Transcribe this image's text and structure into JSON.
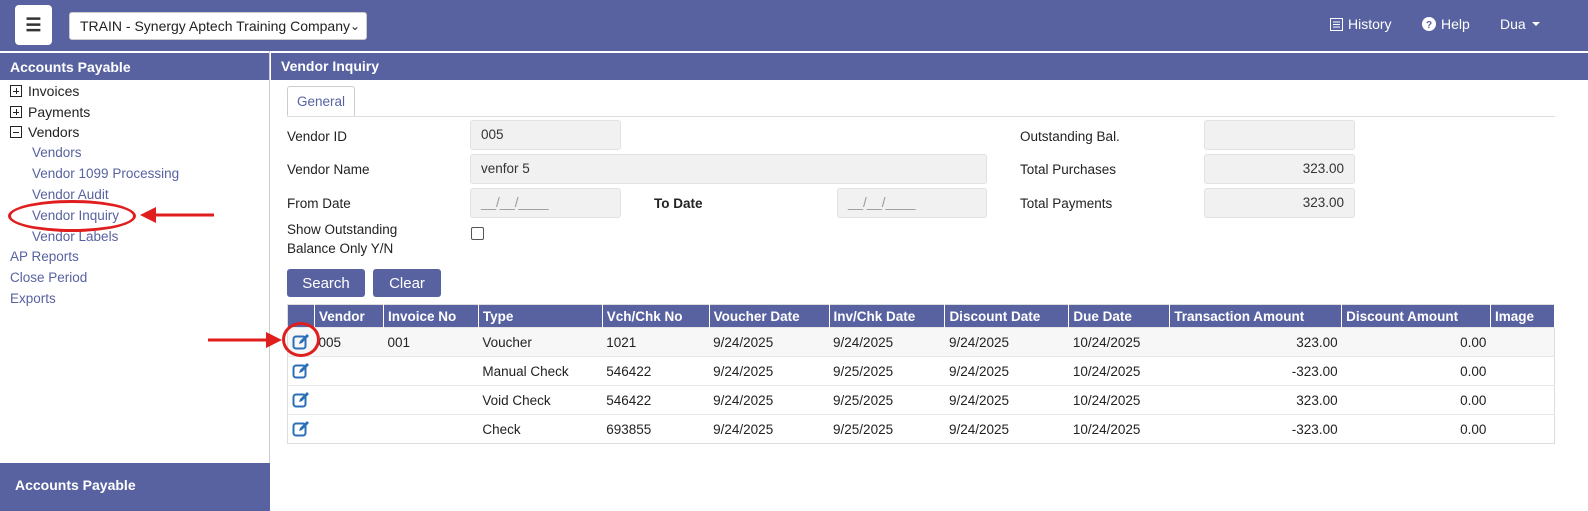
{
  "header": {
    "company": "TRAIN - Synergy Aptech Training Company",
    "history_label": "History",
    "help_label": "Help",
    "user_label": "Dua"
  },
  "sidebar": {
    "title": "Accounts Payable",
    "tree": [
      {
        "label": "Invoices",
        "state": "collapsed"
      },
      {
        "label": "Payments",
        "state": "collapsed"
      },
      {
        "label": "Vendors",
        "state": "expanded"
      }
    ],
    "vendor_links": [
      "Vendors",
      "Vendor 1099 Processing",
      "Vendor Audit",
      "Vendor Inquiry",
      "Vendor Labels"
    ],
    "top_links": [
      "AP Reports",
      "Close Period",
      "Exports"
    ],
    "footer": "Accounts Payable"
  },
  "main": {
    "title": "Vendor Inquiry",
    "tab": "General",
    "form": {
      "vendor_id_label": "Vendor ID",
      "vendor_id": "005",
      "vendor_name_label": "Vendor Name",
      "vendor_name": "venfor 5",
      "from_date_label": "From Date",
      "from_date_ph": "__/__/____",
      "to_date_label": "To Date",
      "to_date_ph": "__/__/____",
      "show_outstanding_label_1": "Show Outstanding",
      "show_outstanding_label_2": "Balance Only Y/N",
      "show_outstanding_checked": false,
      "outstanding_label": "Outstanding Bal.",
      "outstanding": "",
      "total_purchases_label": "Total Purchases",
      "total_purchases": "323.00",
      "total_payments_label": "Total Payments",
      "total_payments": "323.00"
    },
    "buttons": {
      "search": "Search",
      "clear": "Clear"
    },
    "columns": [
      "Vendor",
      "Invoice No",
      "Type",
      "Vch/Chk No",
      "Voucher Date",
      "Inv/Chk Date",
      "Discount Date",
      "Due Date",
      "Transaction Amount",
      "Discount Amount",
      "Image"
    ],
    "rows": [
      {
        "vendor": "005",
        "invoice": "001",
        "type": "Voucher",
        "vch": "1021",
        "voucher_date": "9/24/2025",
        "inv_date": "9/24/2025",
        "disc_date": "9/24/2025",
        "due": "10/24/2025",
        "amount": "323.00",
        "discount": "0.00",
        "image": ""
      },
      {
        "vendor": "",
        "invoice": "",
        "type": "Manual Check",
        "vch": "546422",
        "voucher_date": "9/24/2025",
        "inv_date": "9/25/2025",
        "disc_date": "9/24/2025",
        "due": "10/24/2025",
        "amount": "-323.00",
        "discount": "0.00",
        "image": ""
      },
      {
        "vendor": "",
        "invoice": "",
        "type": "Void Check",
        "vch": "546422",
        "voucher_date": "9/24/2025",
        "inv_date": "9/25/2025",
        "disc_date": "9/24/2025",
        "due": "10/24/2025",
        "amount": "323.00",
        "discount": "0.00",
        "image": ""
      },
      {
        "vendor": "",
        "invoice": "",
        "type": "Check",
        "vch": "693855",
        "voucher_date": "9/24/2025",
        "inv_date": "9/25/2025",
        "disc_date": "9/24/2025",
        "due": "10/24/2025",
        "amount": "-323.00",
        "discount": "0.00",
        "image": ""
      }
    ]
  },
  "theme": {
    "accent": "#5862a0",
    "annotation": "#e01e1e"
  },
  "icons": [
    "menu-icon",
    "history-icon",
    "help-icon",
    "caret-down-icon",
    "edit-icon",
    "plus-icon",
    "minus-icon"
  ]
}
